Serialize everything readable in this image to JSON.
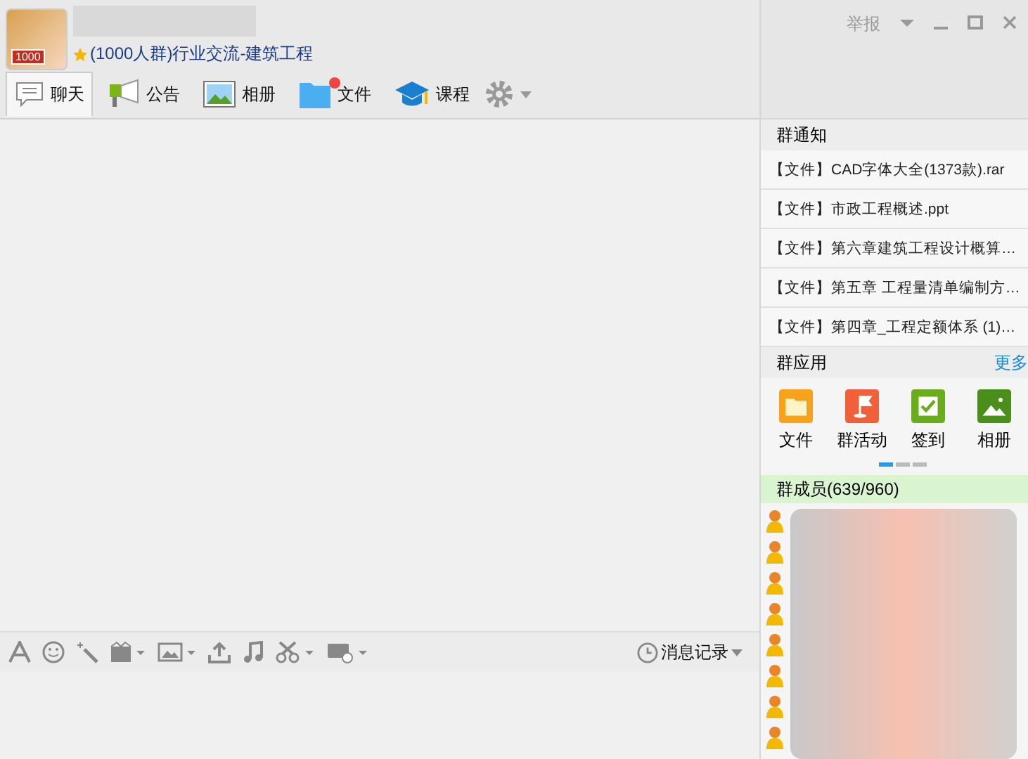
{
  "window": {
    "report": "举报"
  },
  "group": {
    "subtitle": "(1000人群)行业交流-建筑工程",
    "badge": "1000"
  },
  "tabs": [
    {
      "label": "聊天",
      "kind": "chat",
      "selected": true
    },
    {
      "label": "公告",
      "kind": "megaphone",
      "selected": false
    },
    {
      "label": "相册",
      "kind": "photo",
      "selected": false
    },
    {
      "label": "文件",
      "kind": "folder",
      "selected": false,
      "dot": true
    },
    {
      "label": "课程",
      "kind": "cap",
      "selected": false
    }
  ],
  "toolbar": {
    "history": "消息记录"
  },
  "notices": {
    "title": "群通知",
    "items": [
      "【文件】CAD字体大全(1373款).rar",
      "【文件】市政工程概述.ppt",
      "【文件】第六章建筑工程设计概算…",
      "【文件】第五章 工程量清单编制方…",
      "【文件】第四章_工程定额体系 (1)…"
    ]
  },
  "apps": {
    "title": "群应用",
    "more": "更多",
    "items": [
      {
        "label": "文件",
        "color": "#f7a21b",
        "kind": "folder"
      },
      {
        "label": "群活动",
        "color": "#f0603a",
        "kind": "flag"
      },
      {
        "label": "签到",
        "color": "#6aac1c",
        "kind": "check"
      },
      {
        "label": "相册",
        "color": "#4a8f1a",
        "kind": "photo"
      }
    ]
  },
  "members": {
    "title": "群成员(639/960)"
  }
}
